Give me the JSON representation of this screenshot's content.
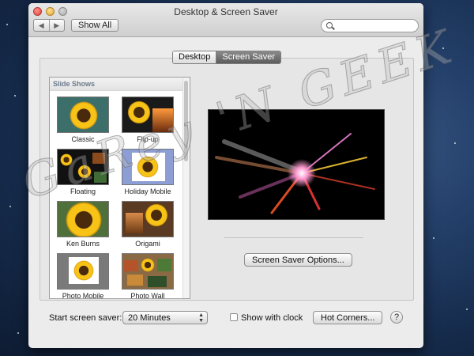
{
  "window": {
    "title": "Desktop & Screen Saver"
  },
  "toolbar": {
    "back_icon": "◀",
    "forward_icon": "▶",
    "show_all_label": "Show All",
    "search_placeholder": ""
  },
  "tabs": [
    {
      "label": "Desktop",
      "selected": false
    },
    {
      "label": "Screen Saver",
      "selected": true
    }
  ],
  "sidebar": {
    "header": "Slide Shows",
    "items": [
      {
        "label": "Classic"
      },
      {
        "label": "Flip-up"
      },
      {
        "label": "Floating"
      },
      {
        "label": "Holiday Mobile"
      },
      {
        "label": "Ken Burns"
      },
      {
        "label": "Origami"
      },
      {
        "label": "Photo Mobile"
      },
      {
        "label": "Photo Wall"
      }
    ]
  },
  "preview": {
    "options_button_label": "Screen Saver Options..."
  },
  "bottom": {
    "start_label": "Start screen saver:",
    "start_value": "20 Minutes",
    "show_clock_label": "Show with clock",
    "show_clock_checked": false,
    "hot_corners_label": "Hot Corners...",
    "help_label": "?"
  },
  "watermark": {
    "text": "GaRey 'N GEEK"
  },
  "colors": {
    "tab_selected": "#6b6b6b",
    "sidebar_header_text": "#6b7b8c"
  }
}
